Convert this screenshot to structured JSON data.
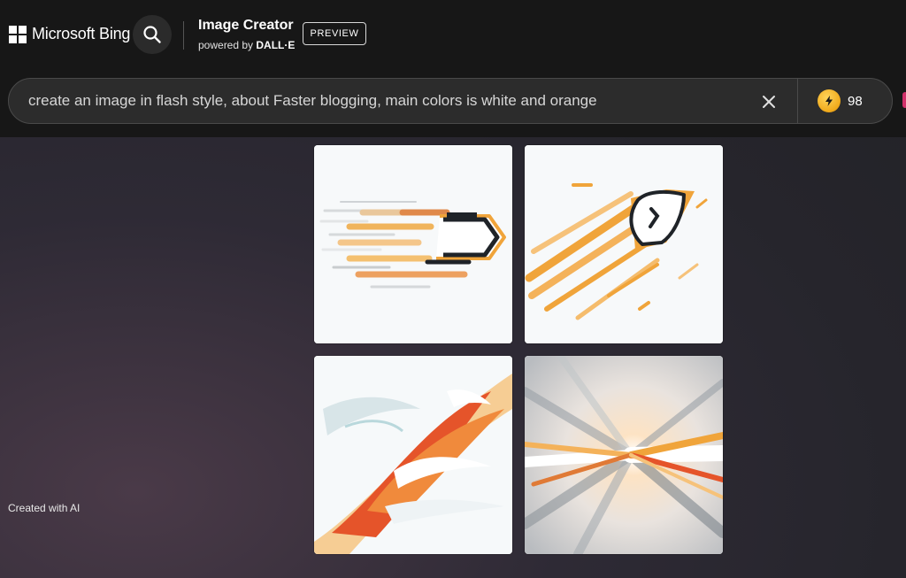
{
  "header": {
    "brand": "Microsoft Bing",
    "title": "Image Creator",
    "subtitle_prefix": "powered by",
    "subtitle_brand": "DALL·E",
    "badge": "PREVIEW"
  },
  "search": {
    "query": "create an image in flash style, about Faster blogging, main colors is white and orange"
  },
  "boosts": {
    "count": "98"
  },
  "footer": {
    "created_label": "Created with AI"
  },
  "results": [
    {
      "name": "generated-image-1",
      "motif": "pen-speed"
    },
    {
      "name": "generated-image-2",
      "motif": "rocket-pen-streaks"
    },
    {
      "name": "generated-image-3",
      "motif": "abstract-swoosh"
    },
    {
      "name": "generated-image-4",
      "motif": "radial-speed-burst"
    }
  ],
  "colors": {
    "orange": "#f0a43a",
    "deep_orange": "#e5542a",
    "topbar": "#171717",
    "coin": "#f0a91a"
  }
}
